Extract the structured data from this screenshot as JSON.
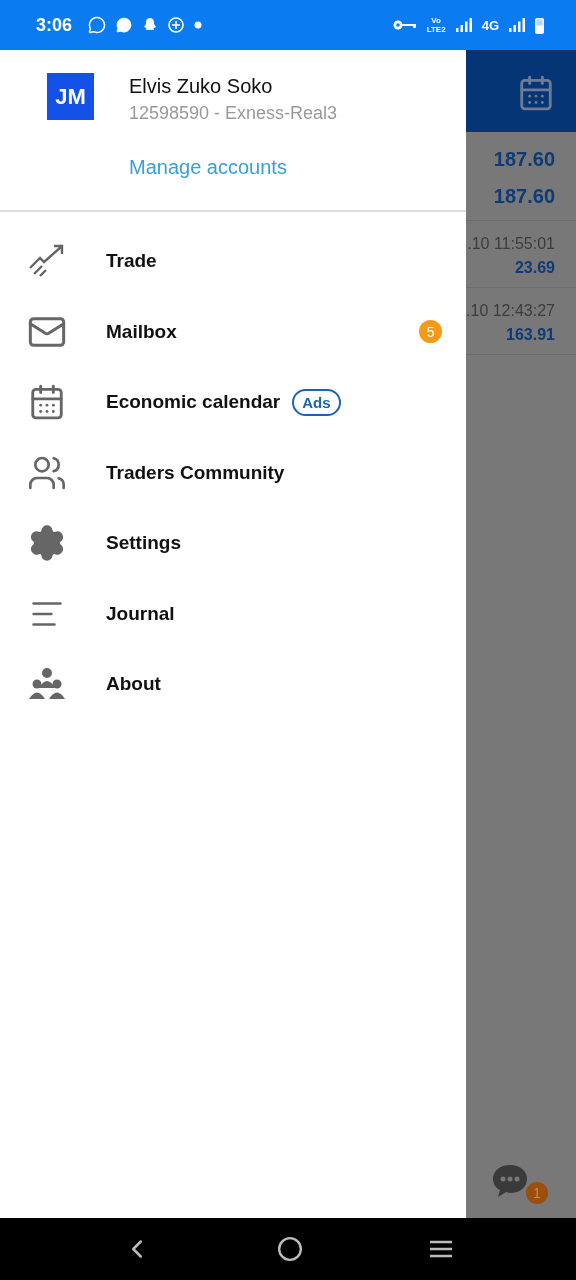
{
  "status_bar": {
    "time": "3:06",
    "volte_top": "Vo",
    "volte_bottom": "LTE2",
    "network": "4G"
  },
  "account": {
    "initials": "JM",
    "name": "Elvis Zuko Soko",
    "number": "12598590 - Exness-Real3",
    "manage_link": "Manage accounts"
  },
  "menu": [
    {
      "label": "Trade"
    },
    {
      "label": "Mailbox",
      "badge": "5"
    },
    {
      "label": "Economic calendar",
      "tag": "Ads"
    },
    {
      "label": "Traders Community"
    },
    {
      "label": "Settings"
    },
    {
      "label": "Journal"
    },
    {
      "label": "About"
    }
  ],
  "background": {
    "prices": [
      "187.60",
      "187.60"
    ],
    "history": [
      {
        "time": ".10 11:55:01",
        "value": "23.69"
      },
      {
        "time": ".10 12:43:27",
        "value": "163.91"
      }
    ],
    "chat_badge": "1"
  }
}
